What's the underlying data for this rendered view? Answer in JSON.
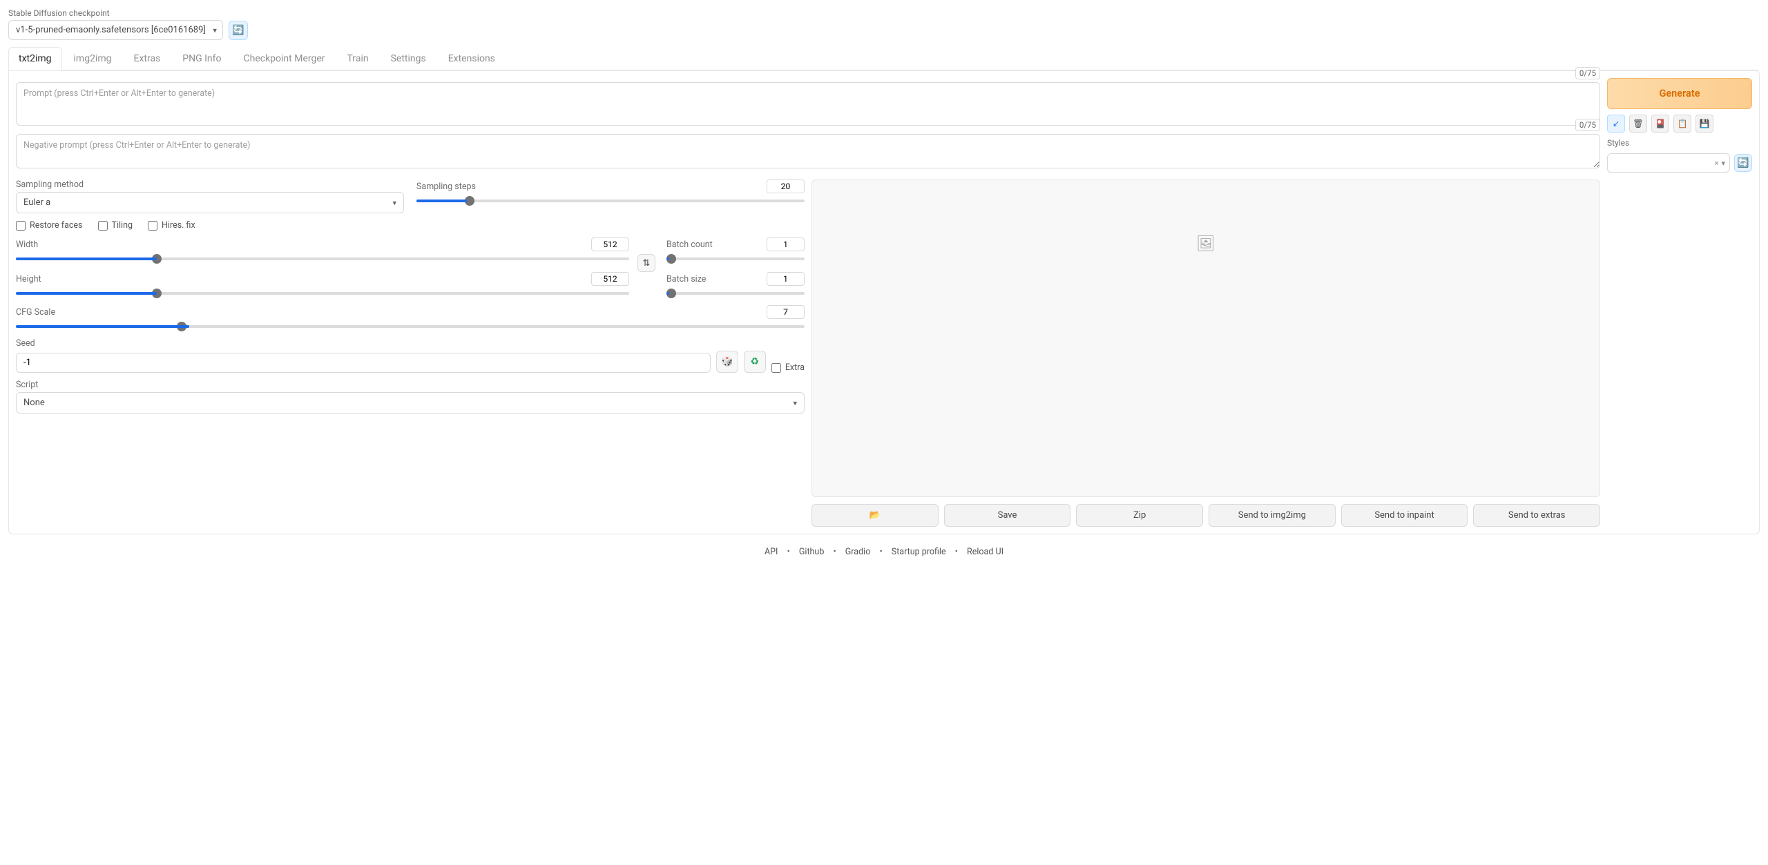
{
  "header": {
    "checkpoint_label": "Stable Diffusion checkpoint",
    "checkpoint_value": "v1-5-pruned-emaonly.safetensors [6ce0161689]"
  },
  "tabs": [
    "txt2img",
    "img2img",
    "Extras",
    "PNG Info",
    "Checkpoint Merger",
    "Train",
    "Settings",
    "Extensions"
  ],
  "prompt": {
    "placeholder": "Prompt (press Ctrl+Enter or Alt+Enter to generate)",
    "counter": "0/75"
  },
  "neg_prompt": {
    "placeholder": "Negative prompt (press Ctrl+Enter or Alt+Enter to generate)",
    "counter": "0/75"
  },
  "generate_label": "Generate",
  "styles_label": "Styles",
  "sampling": {
    "method_label": "Sampling method",
    "method_value": "Euler a",
    "steps_label": "Sampling steps",
    "steps_value": "20"
  },
  "checks": {
    "restore_faces": "Restore faces",
    "tiling": "Tiling",
    "hires_fix": "Hires. fix"
  },
  "dims": {
    "width_label": "Width",
    "width_value": "512",
    "height_label": "Height",
    "height_value": "512",
    "batch_count_label": "Batch count",
    "batch_count_value": "1",
    "batch_size_label": "Batch size",
    "batch_size_value": "1"
  },
  "cfg": {
    "label": "CFG Scale",
    "value": "7"
  },
  "seed": {
    "label": "Seed",
    "value": "-1",
    "extra_label": "Extra"
  },
  "script": {
    "label": "Script",
    "value": "None"
  },
  "actions": {
    "folder": "📂",
    "save": "Save",
    "zip": "Zip",
    "img2img": "Send to img2img",
    "inpaint": "Send to inpaint",
    "extras": "Send to extras"
  },
  "footer": {
    "api": "API",
    "github": "Github",
    "gradio": "Gradio",
    "startup": "Startup profile",
    "reload": "Reload UI"
  }
}
